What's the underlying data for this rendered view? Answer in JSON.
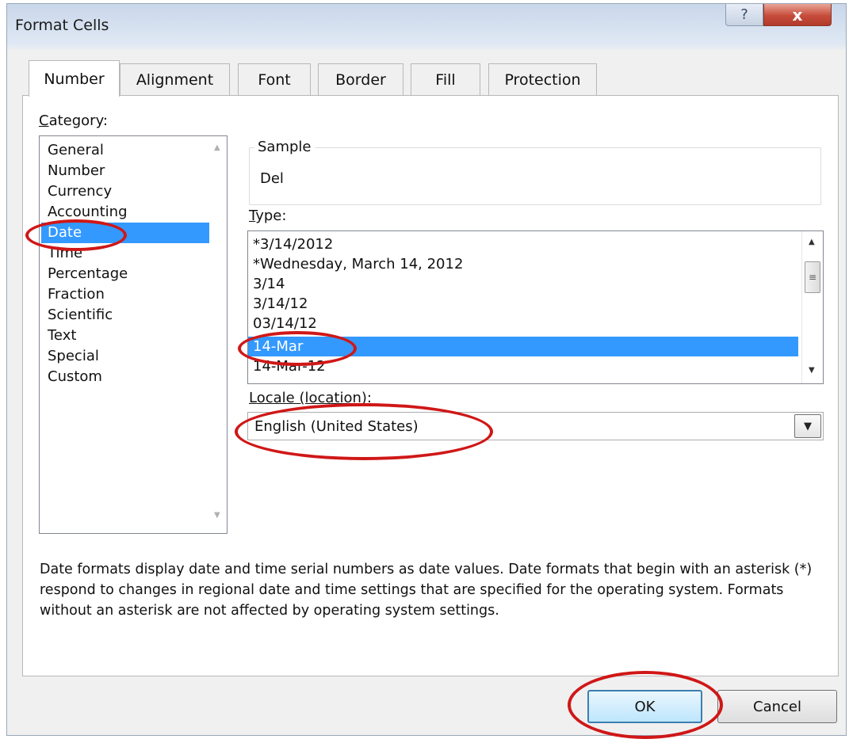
{
  "window": {
    "title": "Format Cells",
    "help_icon": "?",
    "close_icon": "x"
  },
  "tabs": [
    {
      "label": "Number",
      "active": true
    },
    {
      "label": "Alignment"
    },
    {
      "label": "Font"
    },
    {
      "label": "Border"
    },
    {
      "label": "Fill"
    },
    {
      "label": "Protection"
    }
  ],
  "category": {
    "label_prefix": "C",
    "label_rest": "ategory:",
    "items": [
      "General",
      "Number",
      "Currency",
      "Accounting",
      "Date",
      "Time",
      "Percentage",
      "Fraction",
      "Scientific",
      "Text",
      "Special",
      "Custom"
    ],
    "selected": "Date"
  },
  "sample": {
    "label": "Sample",
    "value": "Del"
  },
  "type": {
    "label_prefix": "T",
    "label_rest": "ype:",
    "items": [
      "*3/14/2012",
      "*Wednesday, March 14, 2012",
      "3/14",
      "3/14/12",
      "03/14/12",
      "14-Mar",
      "14-Mar-12"
    ],
    "selected": "14-Mar"
  },
  "locale": {
    "label_prefix": "L",
    "label_rest": "ocale (location):",
    "value": "English (United States)"
  },
  "description": "Date formats display date and time serial numbers as date values.  Date formats that begin with an asterisk (*) respond to changes in regional date and time settings that are specified for the operating system. Formats without an asterisk are not affected by operating system settings.",
  "buttons": {
    "ok": "OK",
    "cancel": "Cancel"
  },
  "colors": {
    "selection": "#3399ff",
    "annotation": "#d01717"
  }
}
